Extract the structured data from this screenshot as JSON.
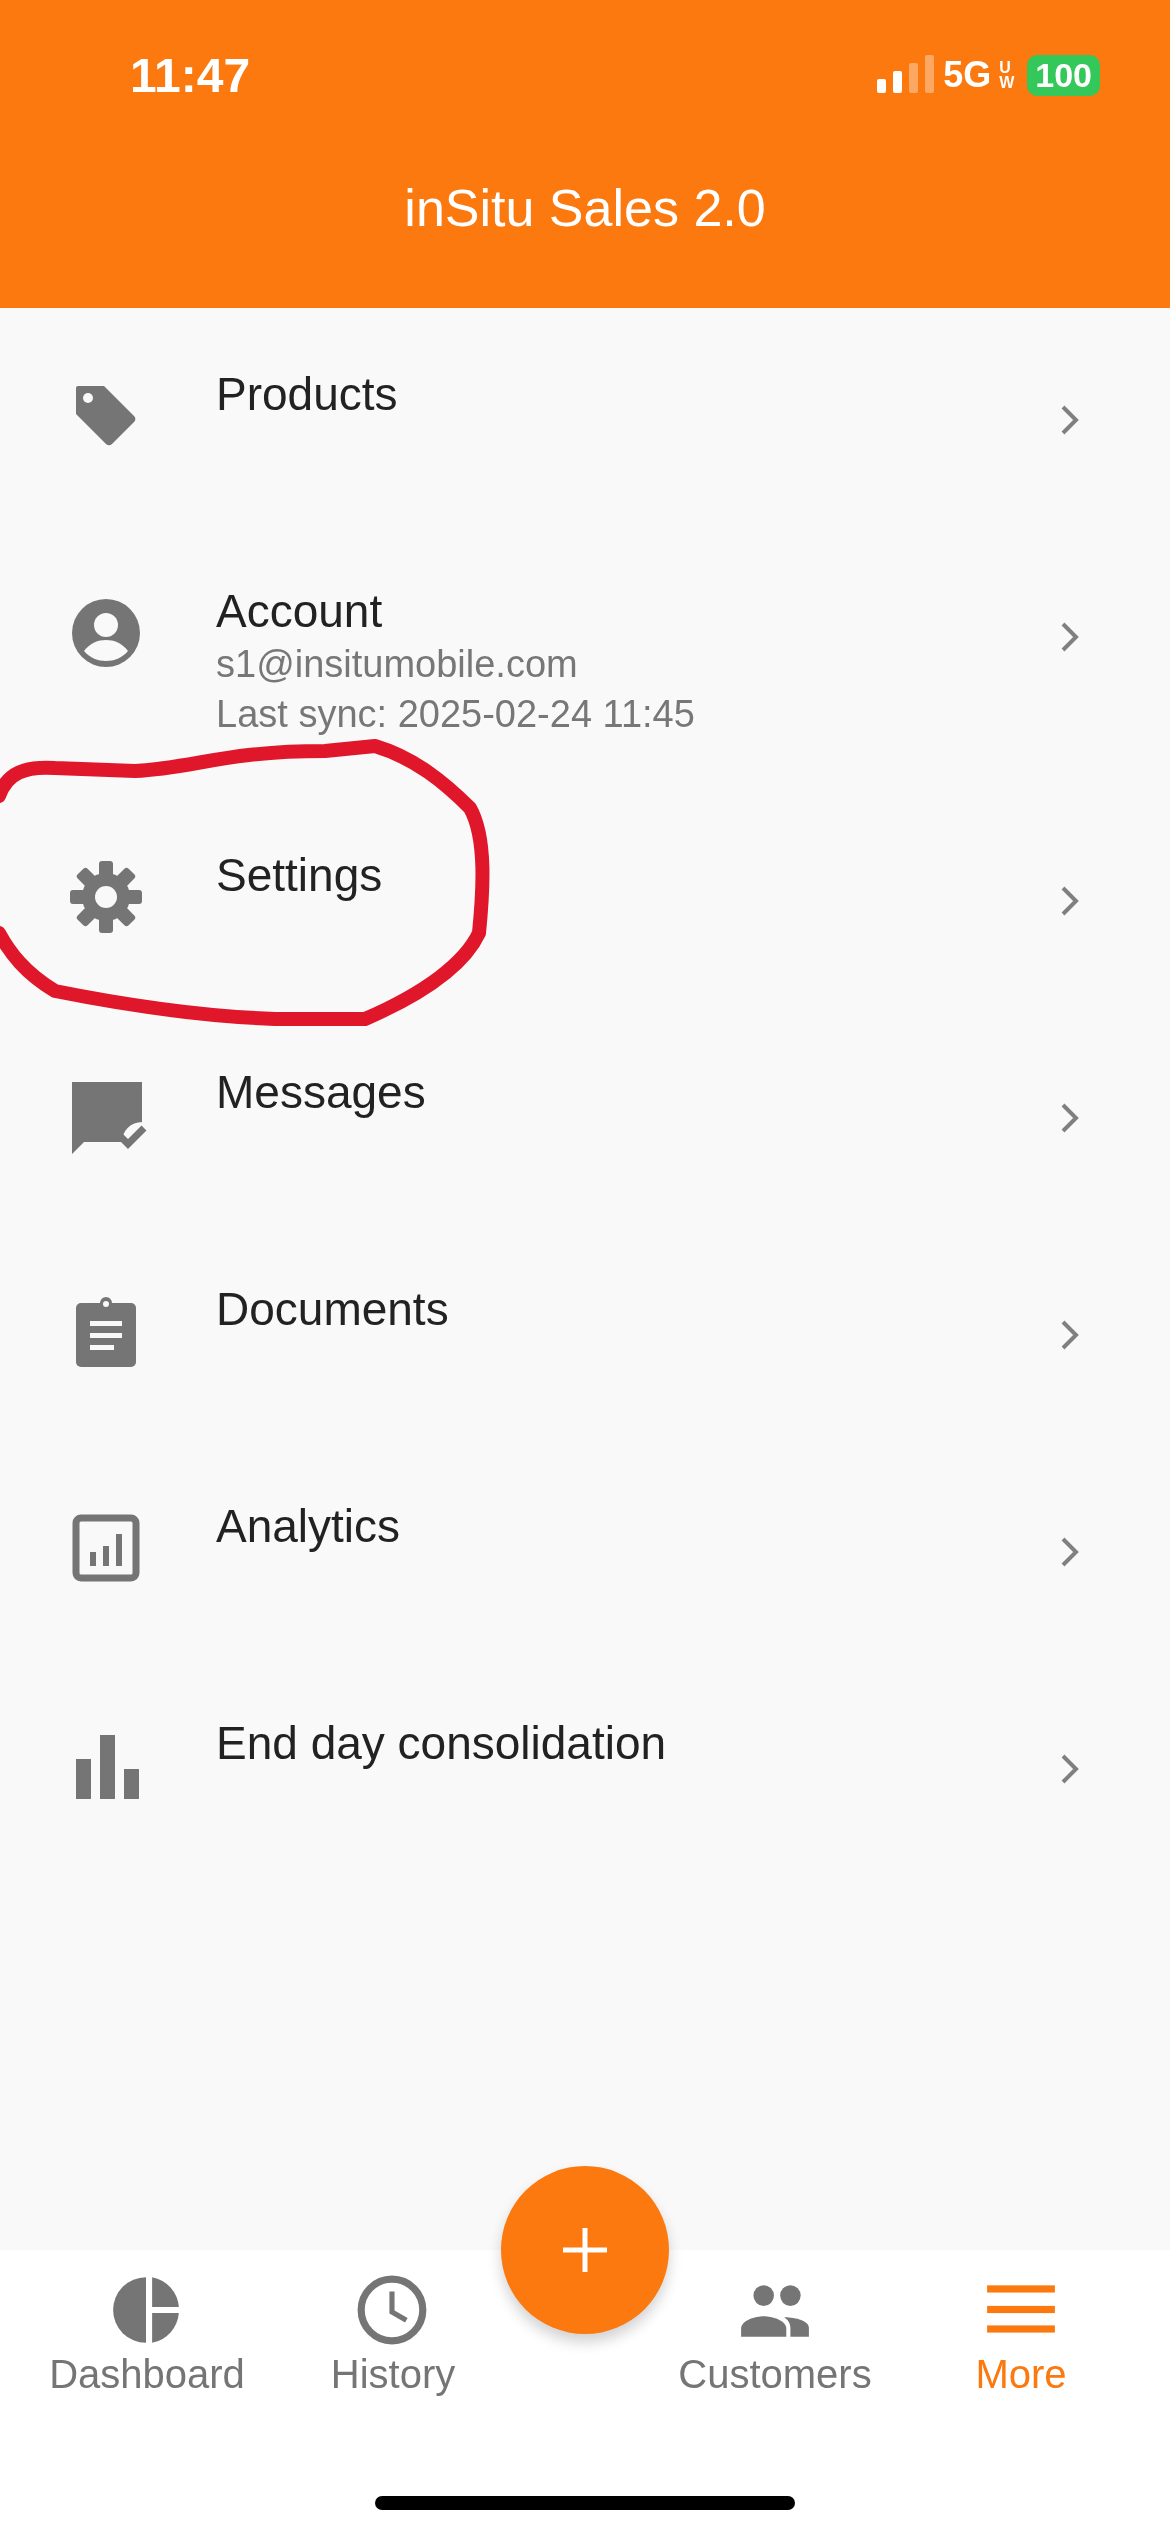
{
  "status_bar": {
    "time": "11:47",
    "network": "5G",
    "network_sub": "UW",
    "battery": "100"
  },
  "app_bar": {
    "title": "inSitu Sales 2.0"
  },
  "menu": [
    {
      "title": "Products",
      "circled": false
    },
    {
      "title": "Account",
      "subtitles": [
        "s1@insitumobile.com",
        "Last sync: 2025-02-24 11:45"
      ],
      "circled": false
    },
    {
      "title": "Settings",
      "circled": true
    },
    {
      "title": "Messages",
      "circled": false
    },
    {
      "title": "Documents",
      "circled": false
    },
    {
      "title": "Analytics",
      "circled": false
    },
    {
      "title": "End day consolidation",
      "circled": false
    }
  ],
  "bottom_nav": [
    {
      "label": "Dashboard",
      "selected": false
    },
    {
      "label": "History",
      "selected": false
    },
    {
      "label": "Customers",
      "selected": false
    },
    {
      "label": "More",
      "selected": true
    }
  ]
}
